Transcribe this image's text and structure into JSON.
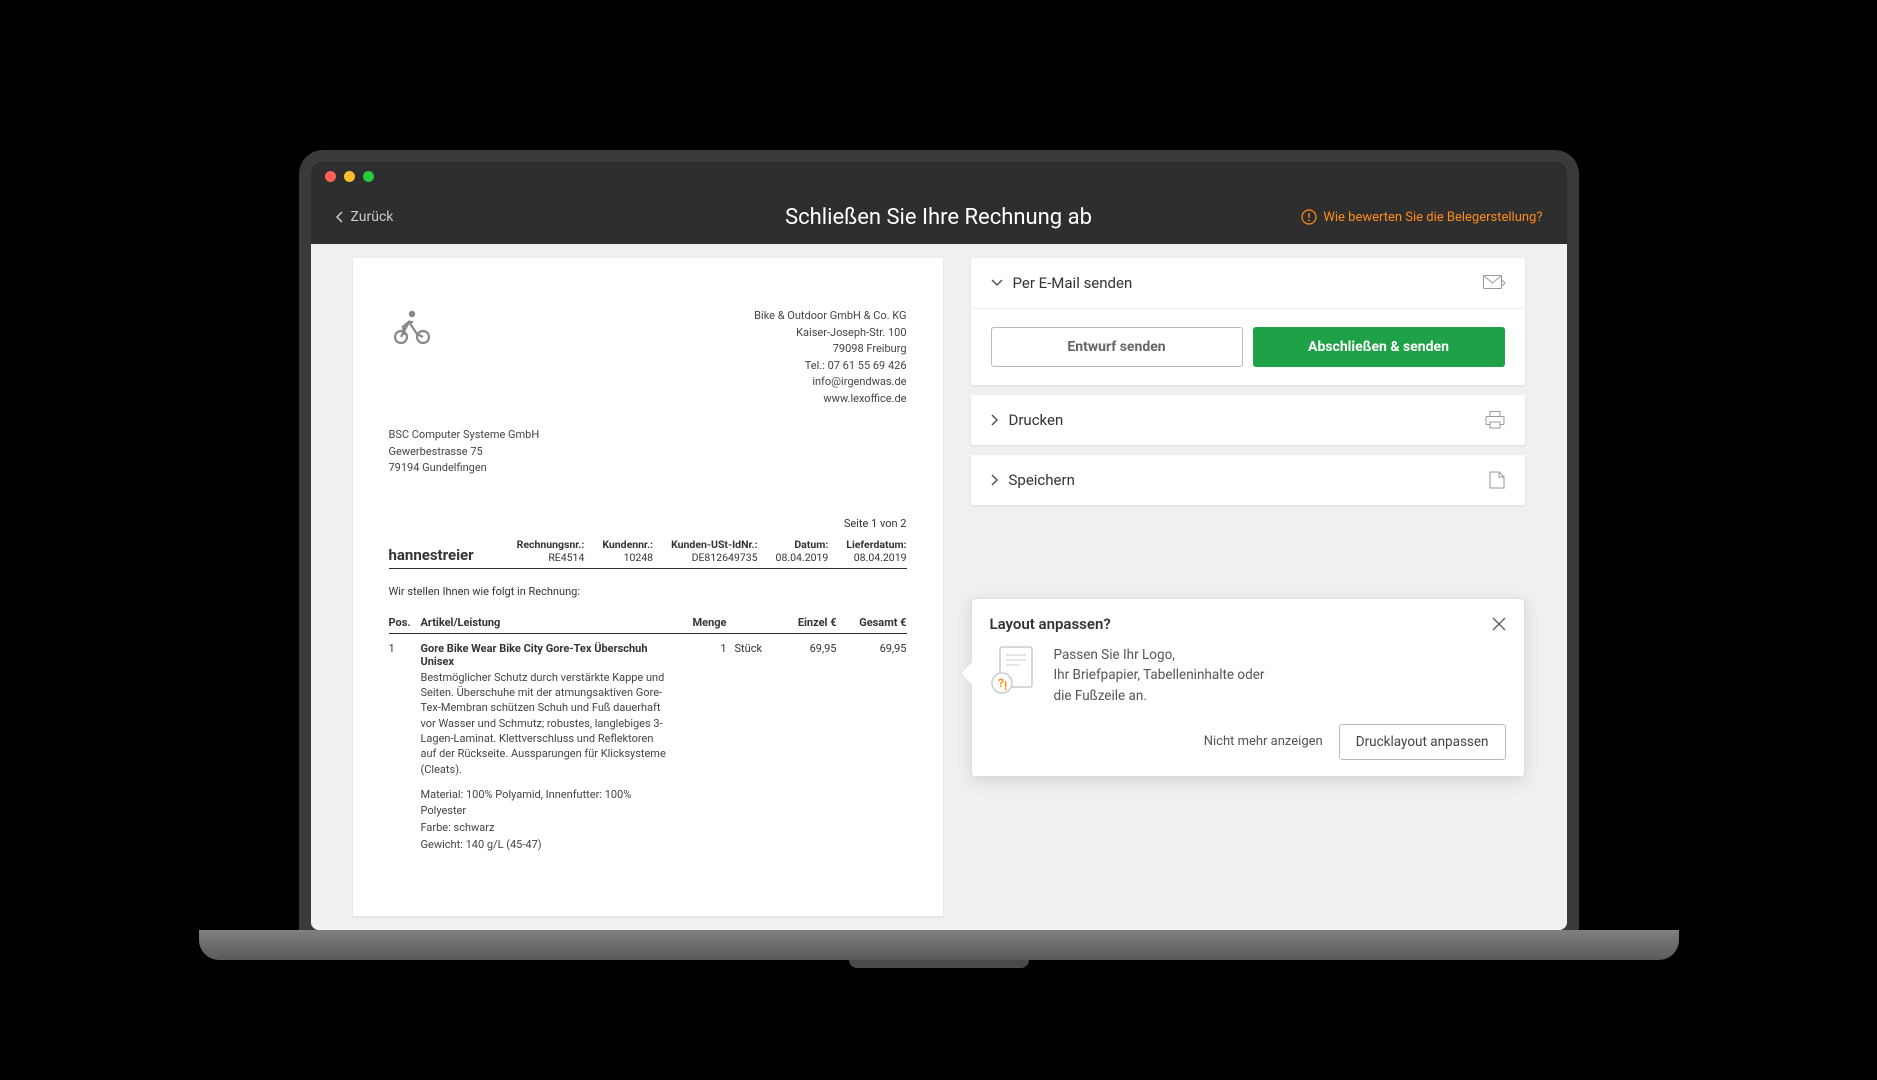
{
  "header": {
    "back": "Zurück",
    "title": "Schließen Sie Ihre Rechnung ab",
    "feedback": "Wie bewerten Sie die Belegerstellung?"
  },
  "invoice": {
    "company": {
      "name": "Bike & Outdoor GmbH & Co. KG",
      "street": "Kaiser-Joseph-Str. 100",
      "city": "79098 Freiburg",
      "tel": "Tel.: 07 61 55 69 426",
      "email": "info@irgendwas.de",
      "web": "www.lexoffice.de"
    },
    "recipient": {
      "name": "BSC Computer Systeme GmbH",
      "street": "Gewerbestrasse 75",
      "city": "79194 Gundelfingen"
    },
    "pageinfo": "Seite 1 von 2",
    "title": "hannestreier",
    "meta": {
      "invoiceNrLabel": "Rechnungsnr.:",
      "invoiceNr": "RE4514",
      "customerNrLabel": "Kundennr.:",
      "customerNr": "10248",
      "vatIdLabel": "Kunden-USt-IdNr.:",
      "vatId": "DE812649735",
      "dateLabel": "Datum:",
      "date": "08.04.2019",
      "deliveryLabel": "Lieferdatum:",
      "delivery": "08.04.2019"
    },
    "intro": "Wir stellen Ihnen wie folgt in Rechnung:",
    "columns": {
      "pos": "Pos.",
      "article": "Artikel/Leistung",
      "qty": "Menge",
      "unitPrice": "Einzel €",
      "total": "Gesamt €"
    },
    "item": {
      "pos": "1",
      "name": "Gore Bike Wear Bike City Gore-Tex Überschuh Unisex",
      "desc": "Bestmöglicher Schutz durch verstärkte Kappe und Seiten. Überschuhe mit der atmungsaktiven Gore-Tex-Membran schützen Schuh und Fuß dauerhaft vor Wasser und Schmutz; robustes, langlebiges 3-Lagen-Laminat. Klettverschluss und Reflektoren auf der Rückseite. Aussparungen für Klicksysteme (Cleats).",
      "material": "Material: 100% Polyamid, Innenfutter: 100% Polyester",
      "color": "Farbe: schwarz",
      "weight": "Gewicht: 140 g/L (45-47)",
      "qty": "1",
      "unit": "Stück",
      "unitPrice": "69,95",
      "total": "69,95"
    }
  },
  "sidebar": {
    "email": {
      "title": "Per E-Mail senden",
      "draft": "Entwurf senden",
      "finalize": "Abschließen & senden"
    },
    "print": "Drucken",
    "save": "Speichern"
  },
  "popover": {
    "title": "Layout anpassen?",
    "line1": "Passen Sie Ihr Logo,",
    "line2": "Ihr Briefpapier, Tabelleninhalte oder",
    "line3": "die Fußzeile an.",
    "dismiss": "Nicht mehr anzeigen",
    "action": "Drucklayout anpassen"
  }
}
